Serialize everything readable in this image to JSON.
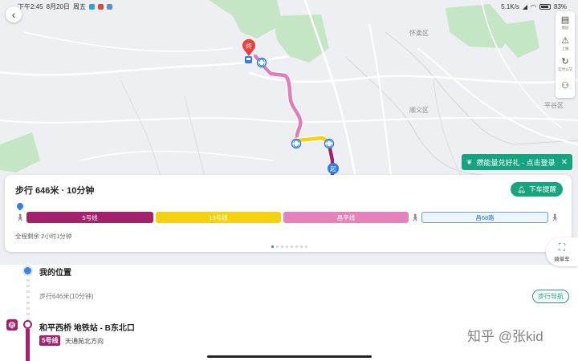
{
  "status_bar": {
    "time": "下午2:45",
    "date": "8月20日",
    "weekday": "周五",
    "network_speed": "5.1K/s",
    "battery": "83%"
  },
  "map": {
    "labels": [
      "怀柔区",
      "顺义区",
      "平谷区"
    ],
    "end_marker": "终",
    "start_marker": "起"
  },
  "toolbar": {
    "items": [
      {
        "icon": "layers-icon",
        "label": "图层"
      },
      {
        "icon": "report-icon",
        "label": "上报"
      },
      {
        "icon": "refresh-icon",
        "label": "实时公交"
      },
      {
        "icon": "walk-people-icon",
        "label": ""
      }
    ]
  },
  "promo": {
    "text": "攒能量兑好礼 - 点击登录",
    "close": "✕"
  },
  "route_card": {
    "title": "步行 646米 · 10分钟",
    "remind_button": "下车提醒",
    "segments": [
      {
        "label": "5号线",
        "type": "subway",
        "color": "#a4226b"
      },
      {
        "label": "13号线",
        "type": "subway",
        "color": "#f5d211"
      },
      {
        "label": "昌平线",
        "type": "subway",
        "color": "#e582b9"
      },
      {
        "label": "昌68路",
        "type": "bus",
        "color": "#6d9fd6"
      }
    ],
    "summary": "全程剩余 2小时1分钟",
    "pager_count": 8,
    "pager_active": 0
  },
  "bike_button": {
    "label": "骑单车"
  },
  "itinerary": {
    "my_location": "我的位置",
    "walk_text": "步行646米(10分钟)",
    "nav_button": "步行导航",
    "station": "和平西桥 地铁站 - B东北口",
    "line_badge": "5号线",
    "direction": "天通苑北方向"
  },
  "watermark": "知乎 @张kid"
}
